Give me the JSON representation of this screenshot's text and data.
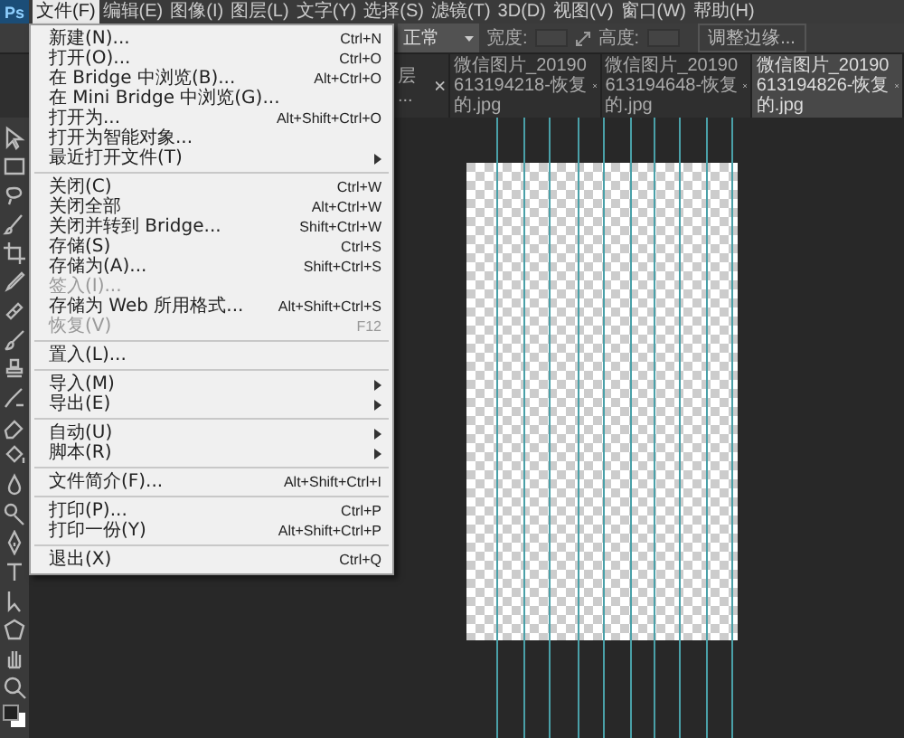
{
  "menubar": {
    "logo": "Ps",
    "items": [
      {
        "label": "文件(F)",
        "selected": true
      },
      {
        "label": "编辑(E)",
        "selected": false
      },
      {
        "label": "图像(I)",
        "selected": false
      },
      {
        "label": "图层(L)",
        "selected": false
      },
      {
        "label": "文字(Y)",
        "selected": false
      },
      {
        "label": "选择(S)",
        "selected": false
      },
      {
        "label": "滤镜(T)",
        "selected": false
      },
      {
        "label": "3D(D)",
        "selected": false
      },
      {
        "label": "视图(V)",
        "selected": false
      },
      {
        "label": "窗口(W)",
        "selected": false
      },
      {
        "label": "帮助(H)",
        "selected": false
      }
    ]
  },
  "options_bar": {
    "mode": "正常",
    "width_label": "宽度:",
    "height_label": "高度:",
    "refine_button": "调整边缘..."
  },
  "tabs": [
    {
      "label": "层 ...",
      "selected": false
    },
    {
      "label": "微信图片_20190613194218-恢复的.jpg",
      "selected": false
    },
    {
      "label": "微信图片_20190613194648-恢复的.jpg",
      "selected": false
    },
    {
      "label": "微信图片_20190613194826-恢复的.jpg",
      "selected": true
    }
  ],
  "file_menu": {
    "groups": [
      [
        {
          "label": "新建(N)...",
          "shortcut": "Ctrl+N",
          "disabled": false,
          "submenu": false
        },
        {
          "label": "打开(O)...",
          "shortcut": "Ctrl+O",
          "disabled": false,
          "submenu": false
        },
        {
          "label": "在 Bridge 中浏览(B)...",
          "shortcut": "Alt+Ctrl+O",
          "disabled": false,
          "submenu": false
        },
        {
          "label": "在 Mini Bridge 中浏览(G)...",
          "disabled": false,
          "submenu": false
        },
        {
          "label": "打开为...",
          "shortcut": "Alt+Shift+Ctrl+O",
          "disabled": false,
          "submenu": false
        },
        {
          "label": "打开为智能对象...",
          "disabled": false,
          "submenu": false
        },
        {
          "label": "最近打开文件(T)",
          "disabled": false,
          "submenu": true
        }
      ],
      [
        {
          "label": "关闭(C)",
          "shortcut": "Ctrl+W",
          "disabled": false,
          "submenu": false
        },
        {
          "label": "关闭全部",
          "shortcut": "Alt+Ctrl+W",
          "disabled": false,
          "submenu": false
        },
        {
          "label": "关闭并转到 Bridge...",
          "shortcut": "Shift+Ctrl+W",
          "disabled": false,
          "submenu": false
        },
        {
          "label": "存储(S)",
          "shortcut": "Ctrl+S",
          "disabled": false,
          "submenu": false
        },
        {
          "label": "存储为(A)...",
          "shortcut": "Shift+Ctrl+S",
          "disabled": false,
          "submenu": false
        },
        {
          "label": "签入(I)...",
          "disabled": true,
          "submenu": false
        },
        {
          "label": "存储为 Web 所用格式...",
          "shortcut": "Alt+Shift+Ctrl+S",
          "disabled": false,
          "submenu": false
        },
        {
          "label": "恢复(V)",
          "shortcut": "F12",
          "disabled": true,
          "submenu": false
        }
      ],
      [
        {
          "label": "置入(L)...",
          "disabled": false,
          "submenu": false
        }
      ],
      [
        {
          "label": "导入(M)",
          "disabled": false,
          "submenu": true
        },
        {
          "label": "导出(E)",
          "disabled": false,
          "submenu": true
        }
      ],
      [
        {
          "label": "自动(U)",
          "disabled": false,
          "submenu": true
        },
        {
          "label": "脚本(R)",
          "disabled": false,
          "submenu": true
        }
      ],
      [
        {
          "label": "文件简介(F)...",
          "shortcut": "Alt+Shift+Ctrl+I",
          "disabled": false,
          "submenu": false
        }
      ],
      [
        {
          "label": "打印(P)...",
          "shortcut": "Ctrl+P",
          "disabled": false,
          "submenu": false
        },
        {
          "label": "打印一份(Y)",
          "shortcut": "Alt+Shift+Ctrl+P",
          "disabled": false,
          "submenu": false
        }
      ],
      [
        {
          "label": "退出(X)",
          "shortcut": "Ctrl+Q",
          "disabled": false,
          "submenu": false
        }
      ]
    ]
  }
}
